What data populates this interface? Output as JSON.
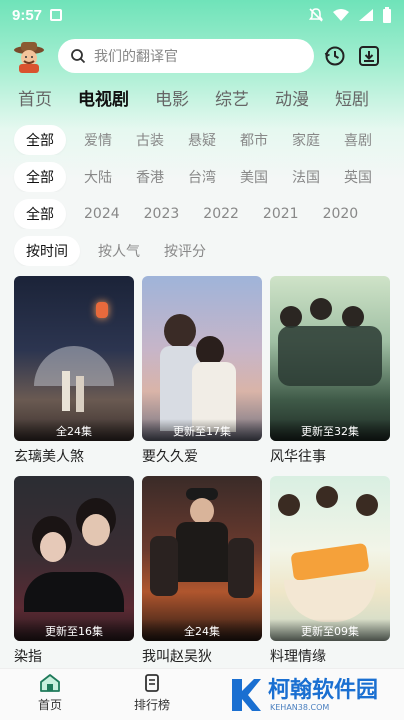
{
  "status": {
    "time": "9:57"
  },
  "search": {
    "placeholder": "我们的翻译官"
  },
  "tabs": [
    {
      "label": "首页",
      "active": false
    },
    {
      "label": "电视剧",
      "active": true
    },
    {
      "label": "电影",
      "active": false
    },
    {
      "label": "综艺",
      "active": false
    },
    {
      "label": "动漫",
      "active": false
    },
    {
      "label": "短剧",
      "active": false
    }
  ],
  "filters": {
    "genre": [
      "全部",
      "爱情",
      "古装",
      "悬疑",
      "都市",
      "家庭",
      "喜剧"
    ],
    "region": [
      "全部",
      "大陆",
      "香港",
      "台湾",
      "美国",
      "法国",
      "英国"
    ],
    "year": [
      "全部",
      "2024",
      "2023",
      "2022",
      "2021",
      "2020"
    ],
    "sort": [
      "按时间",
      "按人气",
      "按评分"
    ]
  },
  "items": [
    {
      "title": "玄璃美人煞",
      "badge": "全24集"
    },
    {
      "title": "要久久爱",
      "badge": "更新至17集"
    },
    {
      "title": "风华往事",
      "badge": "更新至32集"
    },
    {
      "title": "染指",
      "badge": "更新至16集"
    },
    {
      "title": "我叫赵吴狄",
      "badge": "全24集"
    },
    {
      "title": "料理情缘",
      "badge": "更新至09集"
    }
  ],
  "nav": {
    "home": "首页",
    "ranking": "排行榜"
  },
  "watermark": {
    "name": "柯翰软件园",
    "url": "KEHAN38.COM"
  },
  "colors": {
    "accent": "#1fbf8c",
    "brand_watermark": "#1a6fd1"
  }
}
